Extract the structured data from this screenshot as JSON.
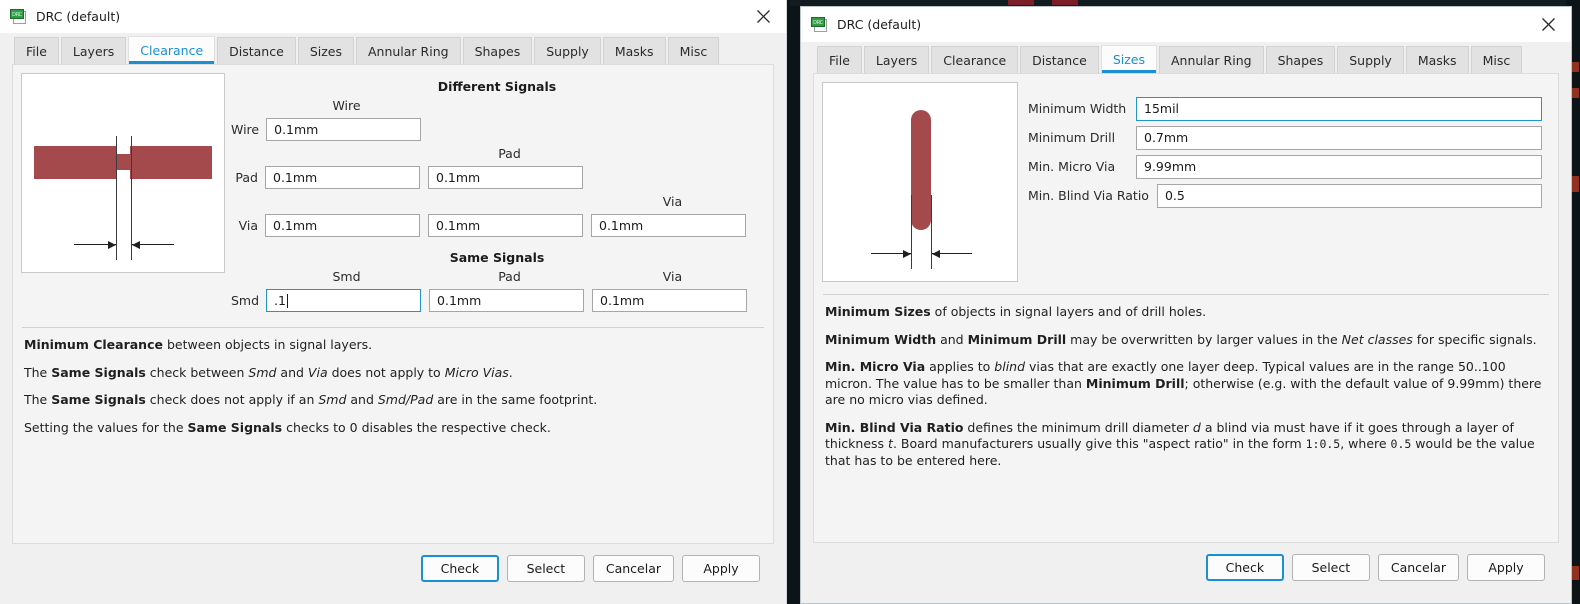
{
  "colors": {
    "accent": "#1a8fd1",
    "pcb_red": "#a44a4c",
    "window_bg": "#f0f0f0",
    "desktop": "#0d1418"
  },
  "left_window": {
    "title": "DRC (default)",
    "icon": "drc-app-icon",
    "close_icon": "close-icon",
    "tabs": [
      {
        "label": "File",
        "active": false
      },
      {
        "label": "Layers",
        "active": false
      },
      {
        "label": "Clearance",
        "active": true
      },
      {
        "label": "Distance",
        "active": false
      },
      {
        "label": "Sizes",
        "active": false
      },
      {
        "label": "Annular Ring",
        "active": false
      },
      {
        "label": "Shapes",
        "active": false
      },
      {
        "label": "Supply",
        "active": false
      },
      {
        "label": "Masks",
        "active": false
      },
      {
        "label": "Misc",
        "active": false
      }
    ],
    "preview": {
      "name": "clearance-preview-diagram"
    },
    "different_signals": {
      "title": "Different Signals",
      "col_headers": [
        "Wire",
        "Pad",
        "Via"
      ],
      "rows": [
        {
          "label": "Wire",
          "values": [
            "0.1mm"
          ]
        },
        {
          "label": "Pad",
          "values": [
            "0.1mm",
            "0.1mm"
          ]
        },
        {
          "label": "Via",
          "values": [
            "0.1mm",
            "0.1mm",
            "0.1mm"
          ]
        }
      ]
    },
    "same_signals": {
      "title": "Same Signals",
      "col_headers": [
        "Smd",
        "Pad",
        "Via"
      ],
      "rows": [
        {
          "label": "Smd",
          "values": [
            ".1",
            "0.1mm",
            "0.1mm"
          ],
          "focused_index": 0
        }
      ]
    },
    "help": [
      "<b>Minimum Clearance</b> between objects in signal layers.",
      "The <b>Same Signals</b> check between <i>Smd</i> and <i>Via</i> does not apply to <i>Micro Vias</i>.",
      "The <b>Same Signals</b> check does not apply if an <i>Smd</i> and <i>Smd/Pad</i> are in the same footprint.",
      "Setting the values for the <b>Same Signals</b> checks to 0 disables the respective check."
    ],
    "buttons": [
      {
        "label": "Check",
        "default": true
      },
      {
        "label": "Select",
        "default": false
      },
      {
        "label": "Cancelar",
        "default": false
      },
      {
        "label": "Apply",
        "default": false
      }
    ]
  },
  "right_window": {
    "title": "DRC (default)",
    "icon": "drc-app-icon",
    "close_icon": "close-icon",
    "tabs": [
      {
        "label": "File",
        "active": false
      },
      {
        "label": "Layers",
        "active": false
      },
      {
        "label": "Clearance",
        "active": false
      },
      {
        "label": "Distance",
        "active": false
      },
      {
        "label": "Sizes",
        "active": true
      },
      {
        "label": "Annular Ring",
        "active": false
      },
      {
        "label": "Shapes",
        "active": false
      },
      {
        "label": "Supply",
        "active": false
      },
      {
        "label": "Masks",
        "active": false
      },
      {
        "label": "Misc",
        "active": false
      }
    ],
    "preview": {
      "name": "sizes-preview-diagram"
    },
    "fields": [
      {
        "label": "Minimum Width",
        "value": "15mil",
        "focused": true
      },
      {
        "label": "Minimum Drill",
        "value": "0.7mm",
        "focused": false
      },
      {
        "label": "Min. Micro Via",
        "value": "9.99mm",
        "focused": false
      },
      {
        "label": "Min. Blind Via Ratio",
        "value": "0.5",
        "focused": false
      }
    ],
    "help": [
      "<b>Minimum Sizes</b> of objects in signal layers and of drill holes.",
      "<b>Minimum Width</b> and <b>Minimum Drill</b> may be overwritten by larger values in the <i>Net classes</i> for specific signals.",
      "<b>Min. Micro Via</b> applies to <i>blind</i> vias that are exactly one layer deep. Typical values are in the range 50..100 micron. The value has to be smaller than <b>Minimum Drill</b>; otherwise (e.g. with the default value of 9.99mm) there are no micro vias defined.",
      "<b>Min. Blind Via Ratio</b> defines the minimum drill diameter <i>d</i> a blind via must have if it goes through a layer of thickness <i>t</i>. Board manufacturers usually give this \"aspect ratio\" in the form <span class=\"mono\">1:0.5</span>, where <span class=\"mono\">0.5</span> would be the value that has to be entered here."
    ],
    "buttons": [
      {
        "label": "Check",
        "default": true
      },
      {
        "label": "Select",
        "default": false
      },
      {
        "label": "Cancelar",
        "default": false
      },
      {
        "label": "Apply",
        "default": false
      }
    ]
  }
}
